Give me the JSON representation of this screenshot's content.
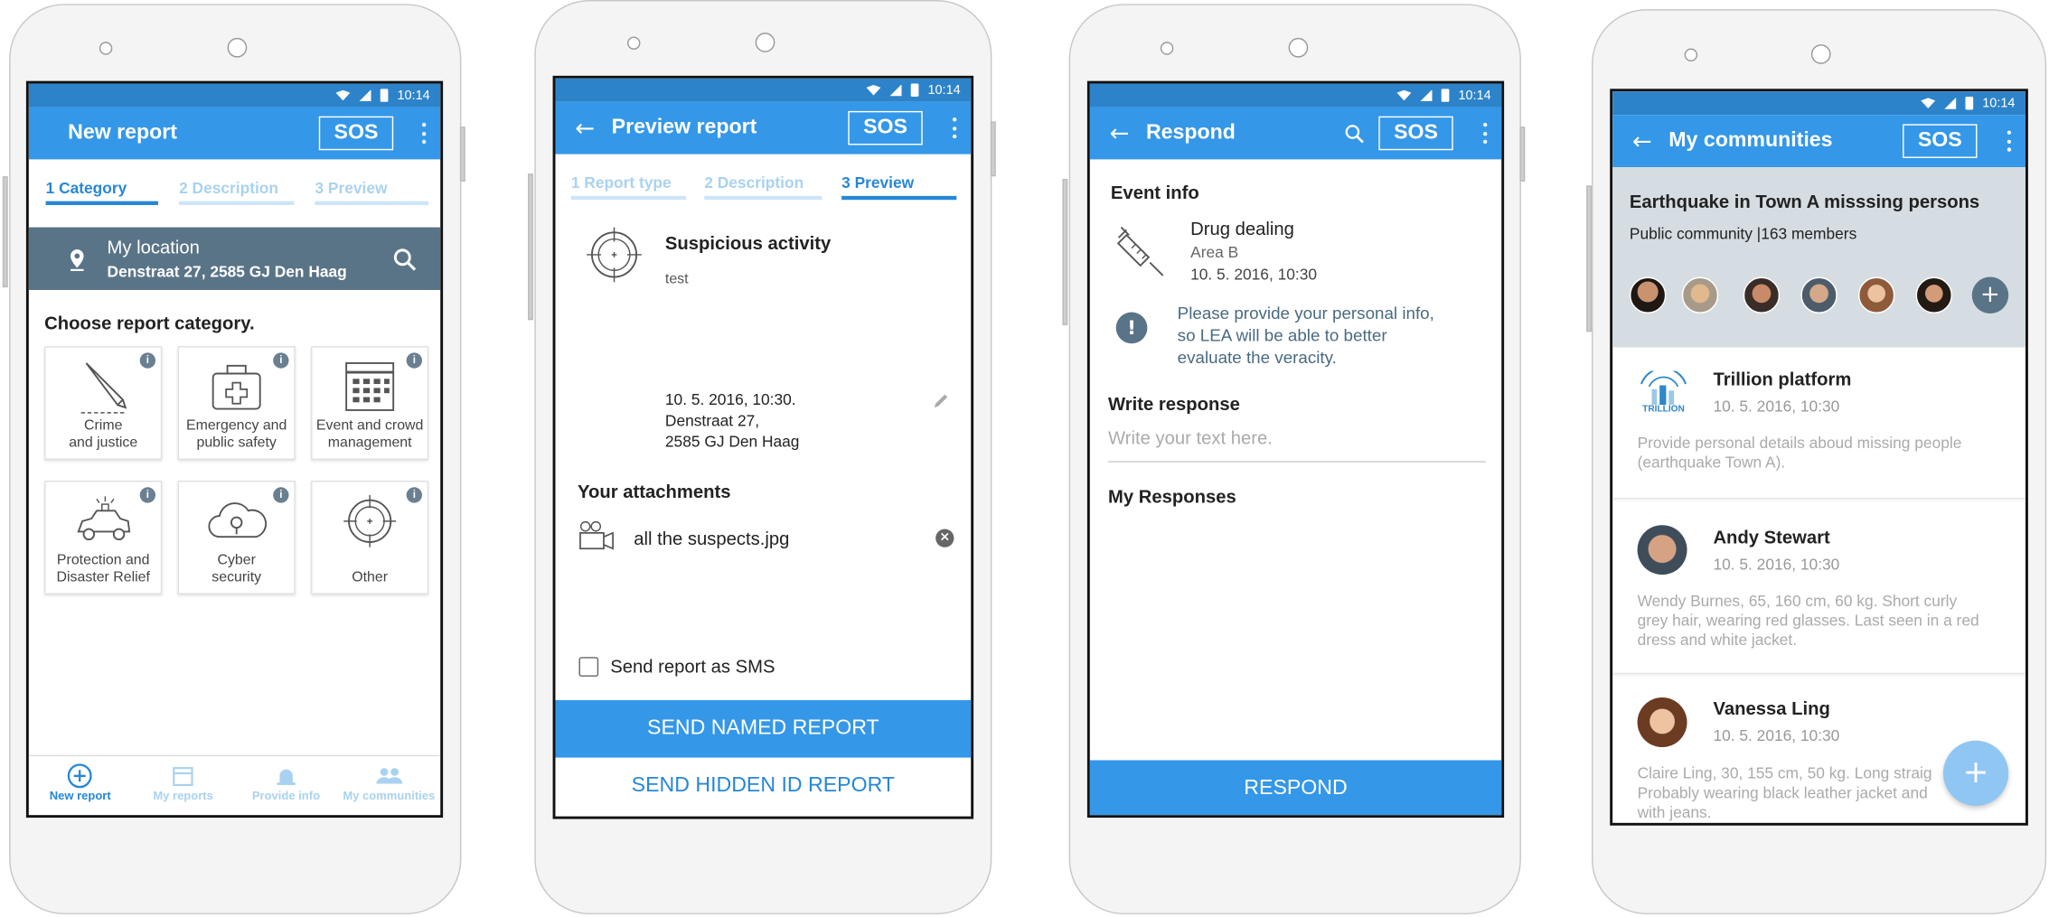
{
  "status": {
    "time": "10:14"
  },
  "screen1": {
    "title": "New report",
    "sos": "SOS",
    "tabs": [
      "1 Category",
      "2 Description",
      "3 Preview"
    ],
    "location": {
      "label": "My location",
      "address": "Denstraat 27, 2585 GJ  Den Haag"
    },
    "prompt": "Choose report category.",
    "categories": [
      {
        "line1": "Crime",
        "line2": "and justice",
        "icon": "knife-icon"
      },
      {
        "line1": "Emergency and",
        "line2": "public safety",
        "icon": "first-aid-kit-icon"
      },
      {
        "line1": "Event and crowd",
        "line2": "management",
        "icon": "calendar-icon"
      },
      {
        "line1": "Protection and",
        "line2": "Disaster Relief",
        "icon": "police-car-icon"
      },
      {
        "line1": "Cyber",
        "line2": "security",
        "icon": "cloud-lock-icon"
      },
      {
        "line1": "Other",
        "line2": "",
        "icon": "crosshair-icon"
      }
    ],
    "bottom_nav": [
      "New report",
      "My reports",
      "Provide info",
      "My communities"
    ]
  },
  "screen2": {
    "title": "Preview report",
    "sos": "SOS",
    "tabs": [
      "1 Report type",
      "2 Description",
      "3 Preview"
    ],
    "report_title": "Suspicious activity",
    "report_desc": "test",
    "datetime": "10. 5. 2016, 10:30.",
    "address1": "Denstraat 27,",
    "address2": "2585 GJ  Den Haag",
    "attachments_heading": "Your attachments",
    "attachment_name": "all the suspects.jpg",
    "sms_label": "Send report as SMS",
    "send_named": "SEND NAMED REPORT",
    "send_hidden": "SEND HIDDEN ID REPORT"
  },
  "screen3": {
    "title": "Respond",
    "sos": "SOS",
    "event_info": "Event info",
    "event_title": "Drug dealing",
    "event_area": "Area B",
    "event_date": "10. 5. 2016, 10:30",
    "notice1": "Please provide your personal info,",
    "notice2": "so LEA will be able to better",
    "notice3": "evaluate the veracity.",
    "write_label": "Write response",
    "write_placeholder": "Write your text here.",
    "my_responses": "My Responses",
    "respond_btn": "RESPOND"
  },
  "screen4": {
    "title": "My communities",
    "sos": "SOS",
    "community_title": "Earthquake in Town A misssing persons",
    "community_meta": "Public community |163 members",
    "posts": [
      {
        "name": "Trillion platform",
        "date": "10. 5. 2016, 10:30",
        "text1": "Provide personal details aboud missing people",
        "text2": "(earthquake Town A).",
        "text3": ""
      },
      {
        "name": "Andy Stewart",
        "date": "10. 5. 2016, 10:30",
        "text1": "Wendy Burnes, 65, 160 cm, 60 kg. Short curly",
        "text2": "grey hair, wearing red glasses. Last seen in a red",
        "text3": "dress and white jacket."
      },
      {
        "name": "Vanessa Ling",
        "date": "10. 5. 2016, 10:30",
        "text1": "Claire Ling, 30, 155 cm, 50 kg. Long straig",
        "text2": "Probably wearing black leather jacket and",
        "text3": "with jeans."
      }
    ],
    "logo_text": "TRILLION"
  },
  "colors": {
    "primary": "#3497e8",
    "status_bar": "#2d83c9",
    "location_bar": "#5a7487",
    "tab_active": "#2687d8",
    "tab_inactive": "#a9d2f0"
  }
}
